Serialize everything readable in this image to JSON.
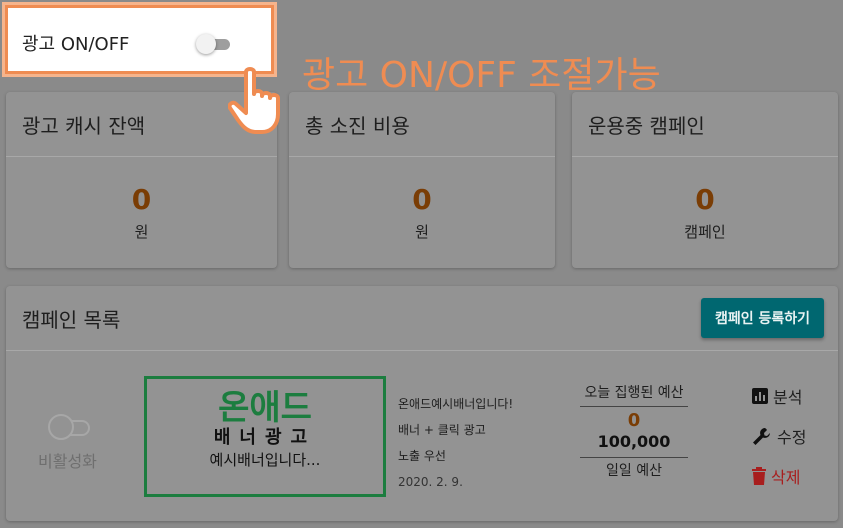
{
  "ad_toggle": {
    "label": "광고 ON/OFF",
    "enabled": false
  },
  "annotation": "광고 ON/OFF 조절가능",
  "stats": [
    {
      "title": "광고 캐시 잔액",
      "value": "0",
      "unit": "원"
    },
    {
      "title": "총 소진 비용",
      "value": "0",
      "unit": "원"
    },
    {
      "title": "운용중 캠페인",
      "value": "0",
      "unit": "캠페인"
    }
  ],
  "campaigns": {
    "title": "캠페인 목록",
    "register_button": "캠페인 등록하기",
    "items": [
      {
        "status_label": "비활성화",
        "active": false,
        "banner": {
          "title": "온애드",
          "subtitle": "배너광고",
          "text": "예시배너입니다..."
        },
        "name": "온애드예시배너입니다!",
        "type": "배너 + 클릭 광고",
        "priority": "노출 우선",
        "date": "2020. 2. 9.",
        "today_label": "오늘 집행된 예산",
        "today_value": "0",
        "daily_budget": "100,000",
        "daily_label": "일일 예산",
        "actions": {
          "analytics": "분석",
          "edit": "수정",
          "delete": "삭제"
        }
      }
    ]
  },
  "colors": {
    "accent": "#ef8c52",
    "value": "#7a3d05",
    "button": "#006770",
    "banner_green": "#1c7d3f",
    "delete": "#a81e1e"
  }
}
